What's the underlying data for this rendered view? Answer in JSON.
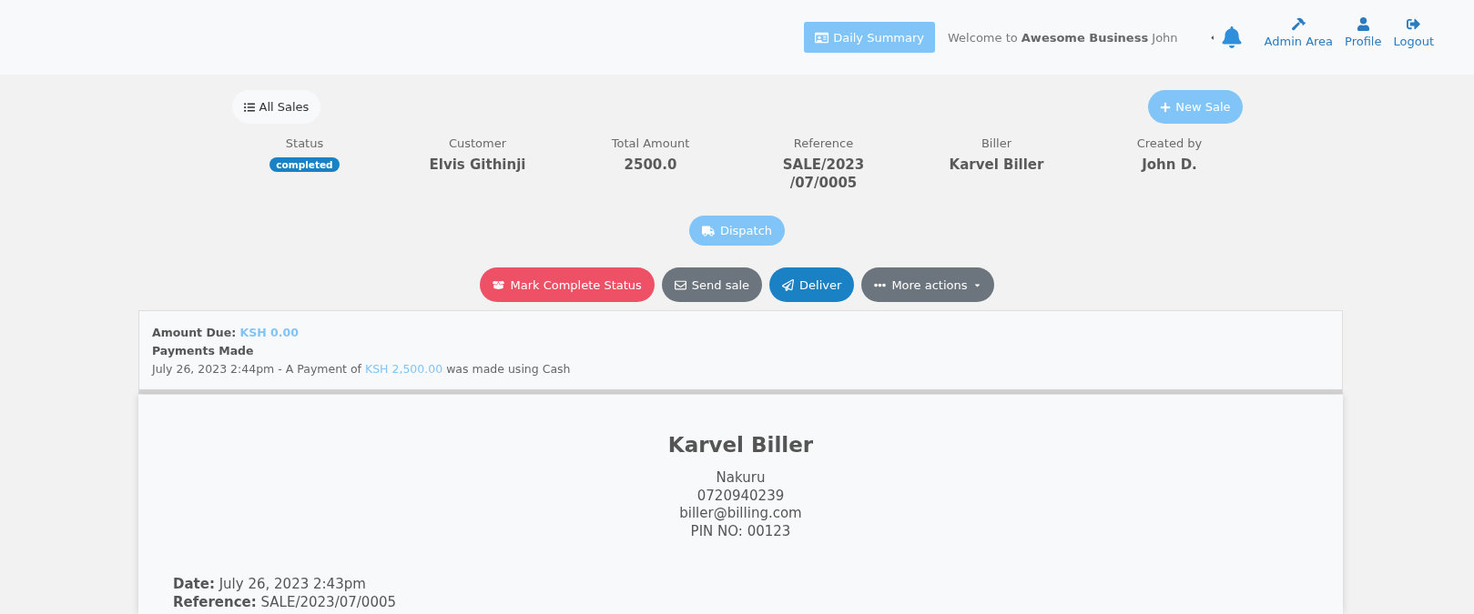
{
  "header": {
    "summary_button": "Daily Summary",
    "welcome": "Welcome to **Awesome Business** John",
    "nav": [
      {
        "label": "Admin Area",
        "kind": "admin"
      },
      {
        "label": "Profile",
        "kind": "profile"
      },
      {
        "label": "Logout",
        "kind": "logout"
      }
    ]
  },
  "toolbar": {
    "all_sales": "All Sales",
    "new_sale": "New Sale"
  },
  "summary": [
    {
      "label": "Status",
      "value": "completed",
      "kind": "badge"
    },
    {
      "label": "Customer",
      "value": "Elvis Githinji",
      "kind": "text"
    },
    {
      "label": "Total Amount",
      "value": "2500.0",
      "kind": "text"
    },
    {
      "label": "Reference",
      "value": "SALE/2023\n/07/0005",
      "kind": "text"
    },
    {
      "label": "Biller",
      "value": "Karvel Biller",
      "kind": "text"
    },
    {
      "label": "Created by",
      "value": "John D.",
      "kind": "text"
    }
  ],
  "dispatch_button": "Dispatch",
  "actions": [
    {
      "label": "Mark Complete Status",
      "kind": "complete"
    },
    {
      "label": "Send sale",
      "kind": "send"
    },
    {
      "label": "Deliver",
      "kind": "deliver"
    },
    {
      "label": "More actions",
      "kind": "more"
    }
  ],
  "payments": {
    "amount_due_label": "Amount Due:",
    "amount_due": "KSH 0.00",
    "title": "Payments Made",
    "entries": [
      {
        "text": "July 26, 2023 2:44pm - A Payment of",
        "amount": "KSH 2,500.00",
        "after": "was made using Cash"
      }
    ]
  },
  "invoice": {
    "biller": "Karvel Biller",
    "address": [
      "Nakuru",
      "0720940239",
      "biller@billing.com",
      "PIN NO: 00123"
    ],
    "details": [
      "**Date:** July 26, 2023 2:43pm",
      "**Reference:** SALE/2023/07/0005"
    ]
  }
}
